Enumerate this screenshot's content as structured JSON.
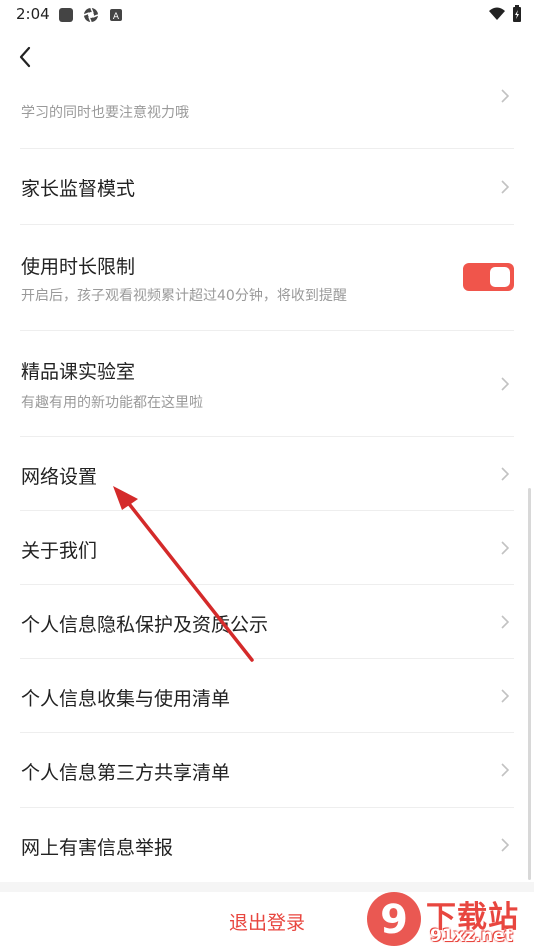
{
  "status_bar": {
    "time": "2:04",
    "left_icons": [
      "square-notification-icon",
      "aperture-icon",
      "a-app-icon"
    ],
    "right_icons": [
      "wifi-icon",
      "battery-icon"
    ]
  },
  "header": {
    "back_icon": "chevron-left-icon"
  },
  "items": [
    {
      "title": "",
      "subtitle": "学习的同时也要注意视力哦",
      "control": "chevron"
    },
    {
      "title": "家长监督模式",
      "subtitle": "",
      "control": "chevron"
    },
    {
      "title": "使用时长限制",
      "subtitle": "开启后，孩子观看视频累计超过40分钟，将收到提醒",
      "control": "toggle",
      "toggle_on": true
    },
    {
      "title": "精品课实验室",
      "subtitle": "有趣有用的新功能都在这里啦",
      "control": "chevron"
    },
    {
      "title": "网络设置",
      "subtitle": "",
      "control": "chevron"
    },
    {
      "title": "关于我们",
      "subtitle": "",
      "control": "chevron"
    },
    {
      "title": "个人信息隐私保护及资质公示",
      "subtitle": "",
      "control": "chevron"
    },
    {
      "title": "个人信息收集与使用清单",
      "subtitle": "",
      "control": "chevron"
    },
    {
      "title": "个人信息第三方共享清单",
      "subtitle": "",
      "control": "chevron"
    },
    {
      "title": "网上有害信息举报",
      "subtitle": "",
      "control": "chevron"
    }
  ],
  "logout": {
    "label": "退出登录"
  },
  "watermark": {
    "brand": "下载站",
    "domain": "91xz.net",
    "logo_text": "9"
  },
  "colors": {
    "accent": "#f0554b",
    "logout_text": "#e8463f",
    "annotation_arrow": "#d42a2a",
    "subtitle": "#9a9a9a",
    "divider": "#eeeeee"
  }
}
